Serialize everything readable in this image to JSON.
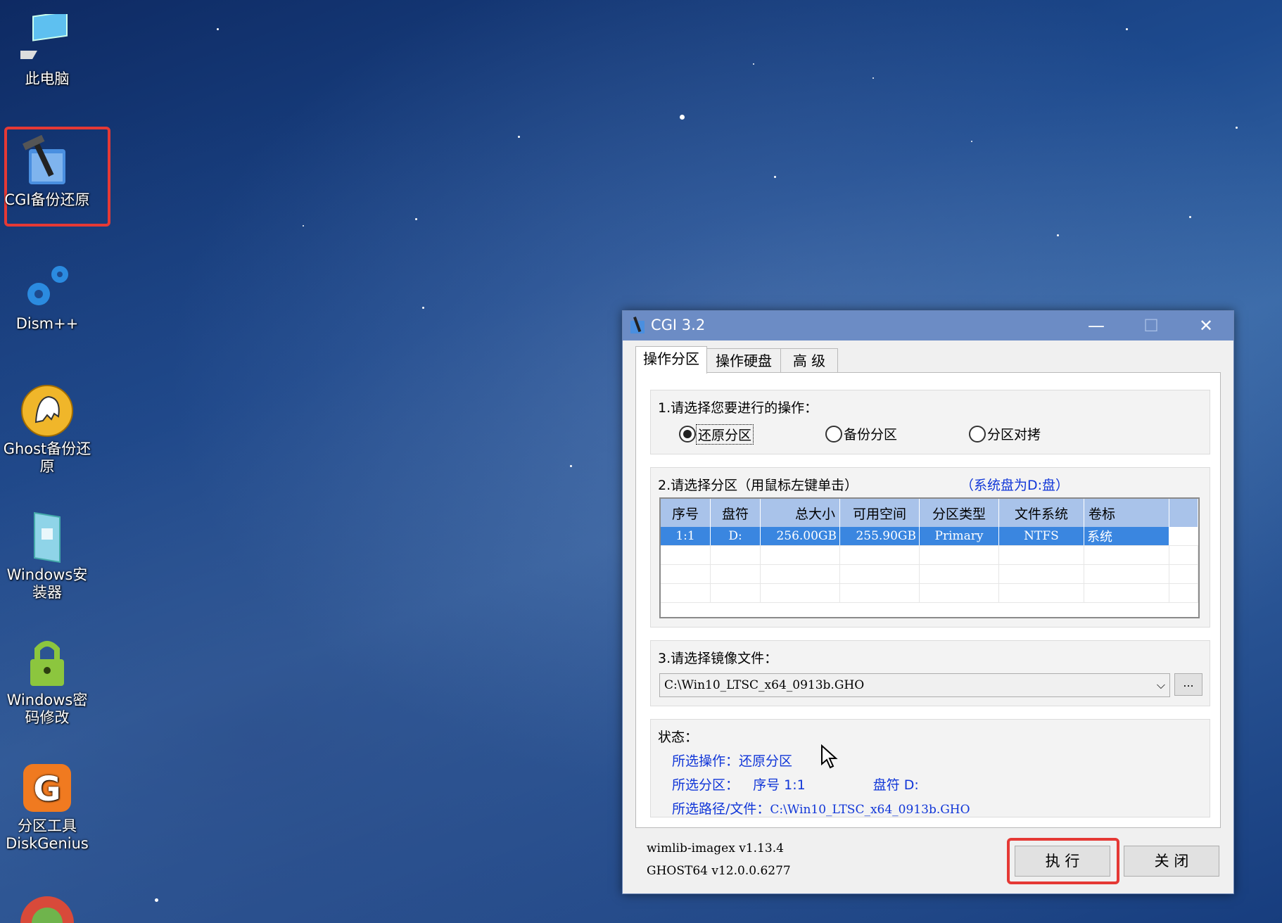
{
  "desktop": {
    "icons": [
      {
        "label": "此电脑"
      },
      {
        "label": "CGI备份还原"
      },
      {
        "label": "Dism++"
      },
      {
        "label": "Ghost备份还原"
      },
      {
        "label": "Windows安装器"
      },
      {
        "label": "Windows密码修改"
      },
      {
        "label": "分区工具DiskGenius"
      }
    ]
  },
  "window": {
    "title": "CGI 3.2",
    "controls": {
      "minimize": "—",
      "maximize": "☐",
      "close": "✕"
    },
    "tabs": [
      "操作分区",
      "操作硬盘",
      "高 级"
    ],
    "section1": {
      "label": "1.请选择您要进行的操作：",
      "options": [
        "还原分区",
        "备份分区",
        "分区对拷"
      ],
      "selected": "还原分区"
    },
    "section2": {
      "label": "2.请选择分区（用鼠标左键单击）",
      "hint": "（系统盘为D:盘）",
      "columns": [
        "序号",
        "盘符",
        "总大小",
        "可用空间",
        "分区类型",
        "文件系统",
        "卷标"
      ],
      "rows": [
        [
          "1:1",
          "D:",
          "256.00GB",
          "255.90GB",
          "Primary",
          "NTFS",
          "系统"
        ]
      ]
    },
    "section3": {
      "label": "3.请选择镜像文件：",
      "image_path": "C:\\Win10_LTSC_x64_0913b.GHO",
      "browse_label": "..."
    },
    "status": {
      "label": "状态：",
      "op_key": "所选操作：",
      "op_value": "还原分区",
      "part_key": "所选分区：",
      "part_seq": "序号 1:1",
      "part_drive": "盘符 D:",
      "path_key": "所选路径/文件：",
      "path_value": "C:\\Win10_LTSC_x64_0913b.GHO"
    },
    "footer": {
      "version1": "wimlib-imagex v1.13.4",
      "version2": "GHOST64 v12.0.0.6277",
      "execute_label": "执 行",
      "close_label": "关 闭"
    }
  },
  "colors": {
    "highlight": "#e53935",
    "titlebar": "#6c8cc5",
    "selection": "#3a86e0",
    "link_blue": "#1036d8"
  }
}
